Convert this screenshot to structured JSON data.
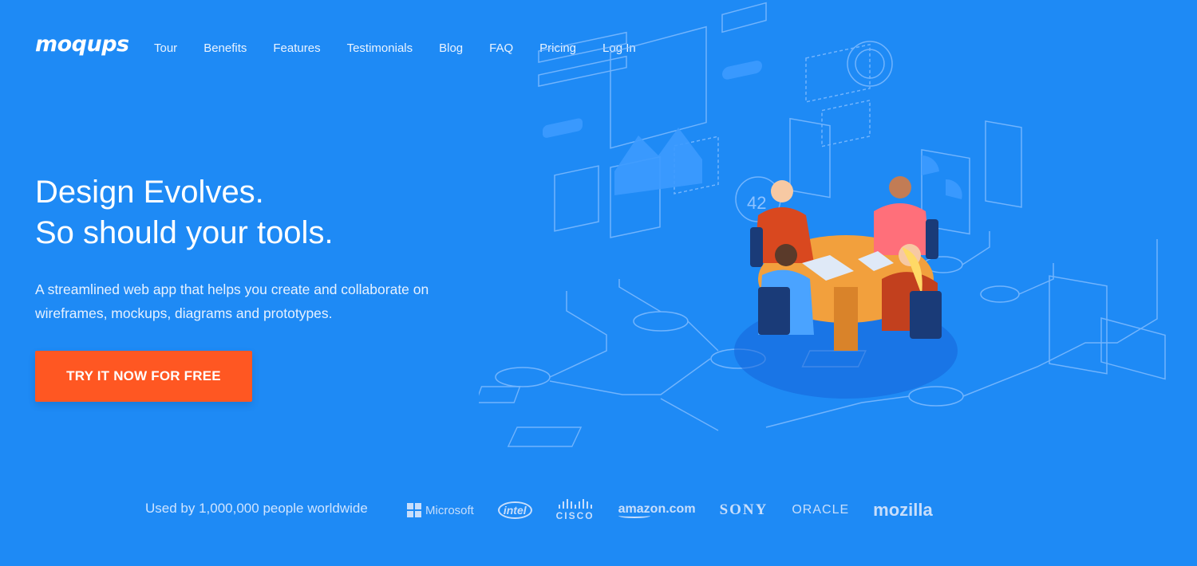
{
  "brand": {
    "logo_text": "moqups"
  },
  "nav": {
    "items": [
      "Tour",
      "Benefits",
      "Features",
      "Testimonials",
      "Blog",
      "FAQ",
      "Pricing",
      "Log In"
    ]
  },
  "hero": {
    "headline_line1": "Design Evolves.",
    "headline_line2": "So should your tools.",
    "subtext": "A streamlined web app that helps you create and collaborate on wireframes, mockups, diagrams and prototypes.",
    "cta_label": "TRY IT NOW FOR FREE"
  },
  "illustration": {
    "counter_label": "42"
  },
  "social_proof": {
    "text": "Used by 1,000,000 people worldwide",
    "logos": [
      "Microsoft",
      "intel",
      "CISCO",
      "amazon.com",
      "SONY",
      "ORACLE",
      "mozilla"
    ]
  },
  "colors": {
    "background": "#1e8af5",
    "cta": "#ff5722",
    "text": "#ffffff"
  }
}
